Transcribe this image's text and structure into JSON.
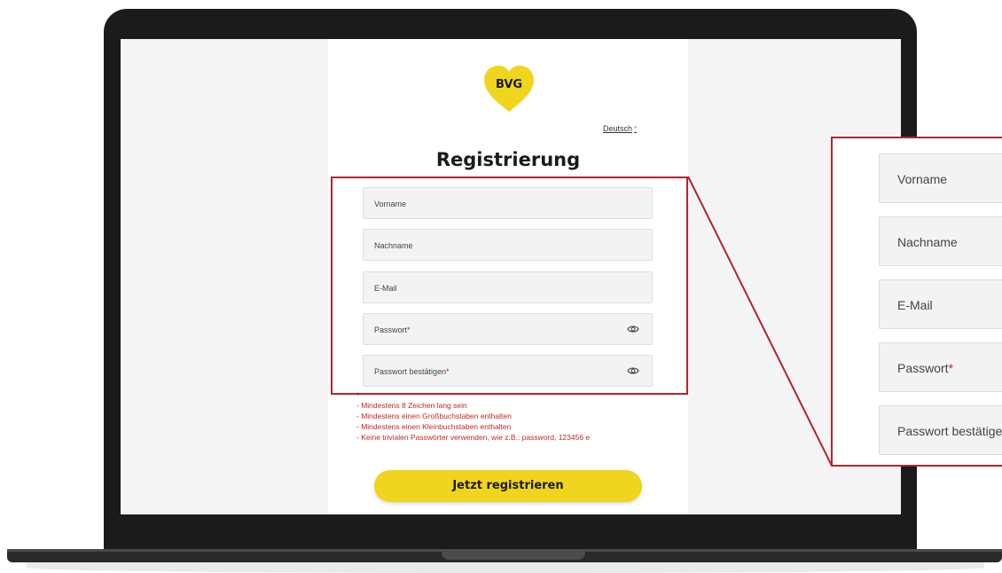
{
  "brand": {
    "logo_text": "BVG",
    "logo_color": "#f0d51e",
    "accent_red": "#b3262b"
  },
  "language": {
    "selected": "Deutsch",
    "caret": "*"
  },
  "form": {
    "title": "Registrierung",
    "fields": [
      {
        "label": "Vorname",
        "required": ""
      },
      {
        "label": "Nachname",
        "required": ""
      },
      {
        "label": "E-Mail",
        "required": ""
      },
      {
        "label": "Passwort",
        "required": "*",
        "icon": "eye-icon"
      },
      {
        "label": "Passwort bestätigen",
        "required": "*",
        "icon": "eye-icon"
      }
    ],
    "hint_marker": "*",
    "password_rules": [
      "- Mindestens 8 Zeichen lang sein",
      "- Mindestens einen Großbuchstaben enthalten",
      "- Mindestens einen Kleinbuchstaben enthalten",
      "- Keine trivialen Passwörter verwenden, wie z.B.: password, 123456 e"
    ],
    "submit_label": "Jetzt registrieren"
  },
  "zoom": {
    "fields": [
      {
        "label": "Vorname",
        "required": ""
      },
      {
        "label": "Nachname",
        "required": ""
      },
      {
        "label": "E-Mail",
        "required": ""
      },
      {
        "label": "Passwort",
        "required": "*"
      },
      {
        "label": "Passwort bestätigen",
        "required": "*"
      }
    ]
  }
}
